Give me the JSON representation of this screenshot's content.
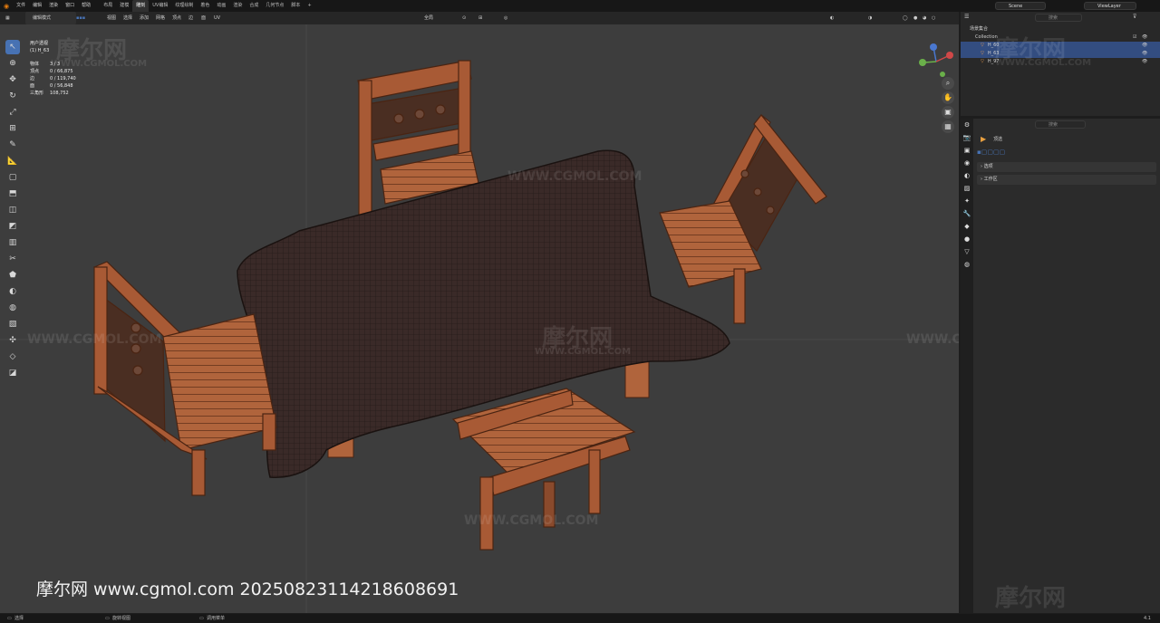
{
  "menu": [
    "文件",
    "编辑",
    "渲染",
    "窗口",
    "帮助"
  ],
  "workspaces": [
    "布局",
    "建模",
    "雕刻",
    "UV编辑",
    "纹理绘制",
    "着色",
    "动画",
    "渲染",
    "合成",
    "几何节点",
    "脚本"
  ],
  "active_workspace": "雕刻",
  "scene_name": "Scene",
  "view_layer": "ViewLayer",
  "viewport_header": {
    "mode": "编辑模式",
    "menus": [
      "视图",
      "选择",
      "添加",
      "网格",
      "顶点",
      "边",
      "面",
      "UV"
    ],
    "transform": "全局",
    "options": "选项"
  },
  "overlay_stats": {
    "view": "用户透视",
    "object_name": "(1) H_63",
    "rows": [
      {
        "label": "物体",
        "value": "3 / 3"
      },
      {
        "label": "顶点",
        "value": "0 / 66,875"
      },
      {
        "label": "边",
        "value": "0 / 119,740"
      },
      {
        "label": "面",
        "value": "0 / 56,848"
      },
      {
        "label": "三角形",
        "value": "108,752"
      }
    ]
  },
  "outliner": {
    "search_placeholder": "搜索",
    "root": "场景集合",
    "collection": "Collection",
    "items": [
      "H_60",
      "H_63",
      "H_97"
    ]
  },
  "properties": {
    "search_placeholder": "搜索",
    "section": "顶选",
    "panels": [
      "选项",
      "工作区"
    ]
  },
  "status": {
    "left": "选择",
    "middle": "旋转视图",
    "right": "调用菜单",
    "version": "4.1"
  },
  "watermarks": {
    "cn": "摩尔网",
    "url": "WWW.CGMOL.COM"
  },
  "caption": "摩尔网 www.cgmol.com 20250823114218608691",
  "colors": {
    "wood": "#a85a35",
    "wood_dark": "#5b2c16",
    "cloth": "#3a2a28",
    "selection": "#334d80",
    "accent": "#4772b3"
  }
}
